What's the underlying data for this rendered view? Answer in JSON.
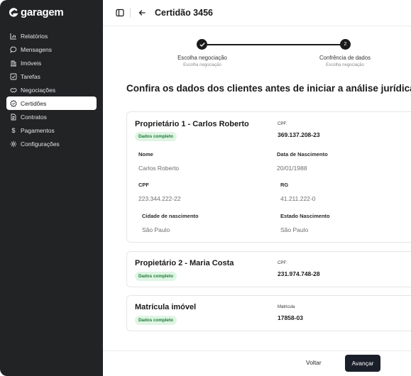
{
  "brand": {
    "name": "garagem"
  },
  "sidebar": {
    "items": [
      {
        "label": "Relatórios",
        "icon": "bar-chart-icon"
      },
      {
        "label": "Mensagens",
        "icon": "chat-bubble-icon"
      },
      {
        "label": "Imóveis",
        "icon": "building-icon"
      },
      {
        "label": "Tarefas",
        "icon": "checklist-icon"
      },
      {
        "label": "Negociações",
        "icon": "handshake-icon"
      },
      {
        "label": "Certidões",
        "icon": "badge-icon",
        "active": true
      },
      {
        "label": "Contratos",
        "icon": "document-icon"
      },
      {
        "label": "Pagamentos",
        "icon": "dollar-icon"
      },
      {
        "label": "Configurações",
        "icon": "gear-icon"
      }
    ]
  },
  "header": {
    "title": "Certidão 3456"
  },
  "stepper": {
    "steps": [
      {
        "label": "Escolha negociação",
        "sub": "Escolha negociação",
        "done": true
      },
      {
        "label": "Confrência de dados",
        "sub": "Escolha negociação",
        "number": "2"
      }
    ]
  },
  "main": {
    "title": "Confira os dados dos clientes antes de iniciar a análise jurídica",
    "cards": [
      {
        "title": "Proprietário 1 - Carlos Roberto",
        "badge": "Dados completo",
        "id_label": "CPF:",
        "id_value": "369.137.208-23",
        "fields": [
          {
            "label": "Nome",
            "value": "Carlos Roberto"
          },
          {
            "label": "Data de Nascimento",
            "value": "20/01/1988"
          },
          {
            "label": "CPF",
            "value": "223.344.222-22"
          },
          {
            "label": "RG",
            "value": "41.211.222-0"
          },
          {
            "label": "Cidade de nascimento",
            "value": "São Paulo"
          },
          {
            "label": "Estado Nascimento",
            "value": "São Paulo"
          }
        ]
      },
      {
        "title": "Propietário 2 - Maria Costa",
        "badge": "Dados completo",
        "id_label": "CPF:",
        "id_value": "231.974.748-28"
      },
      {
        "title": "Matrícula imóvel",
        "badge": "Dados completo",
        "id_label": "Matricula",
        "id_value": "17858-03"
      }
    ]
  },
  "footer": {
    "back_label": "Voltar",
    "next_label": "Avançar"
  },
  "colors": {
    "sidebar_bg": "#222325",
    "badge_bg": "#dff5e4",
    "badge_text": "#1f7a37",
    "primary_button": "#1b1f2a"
  }
}
